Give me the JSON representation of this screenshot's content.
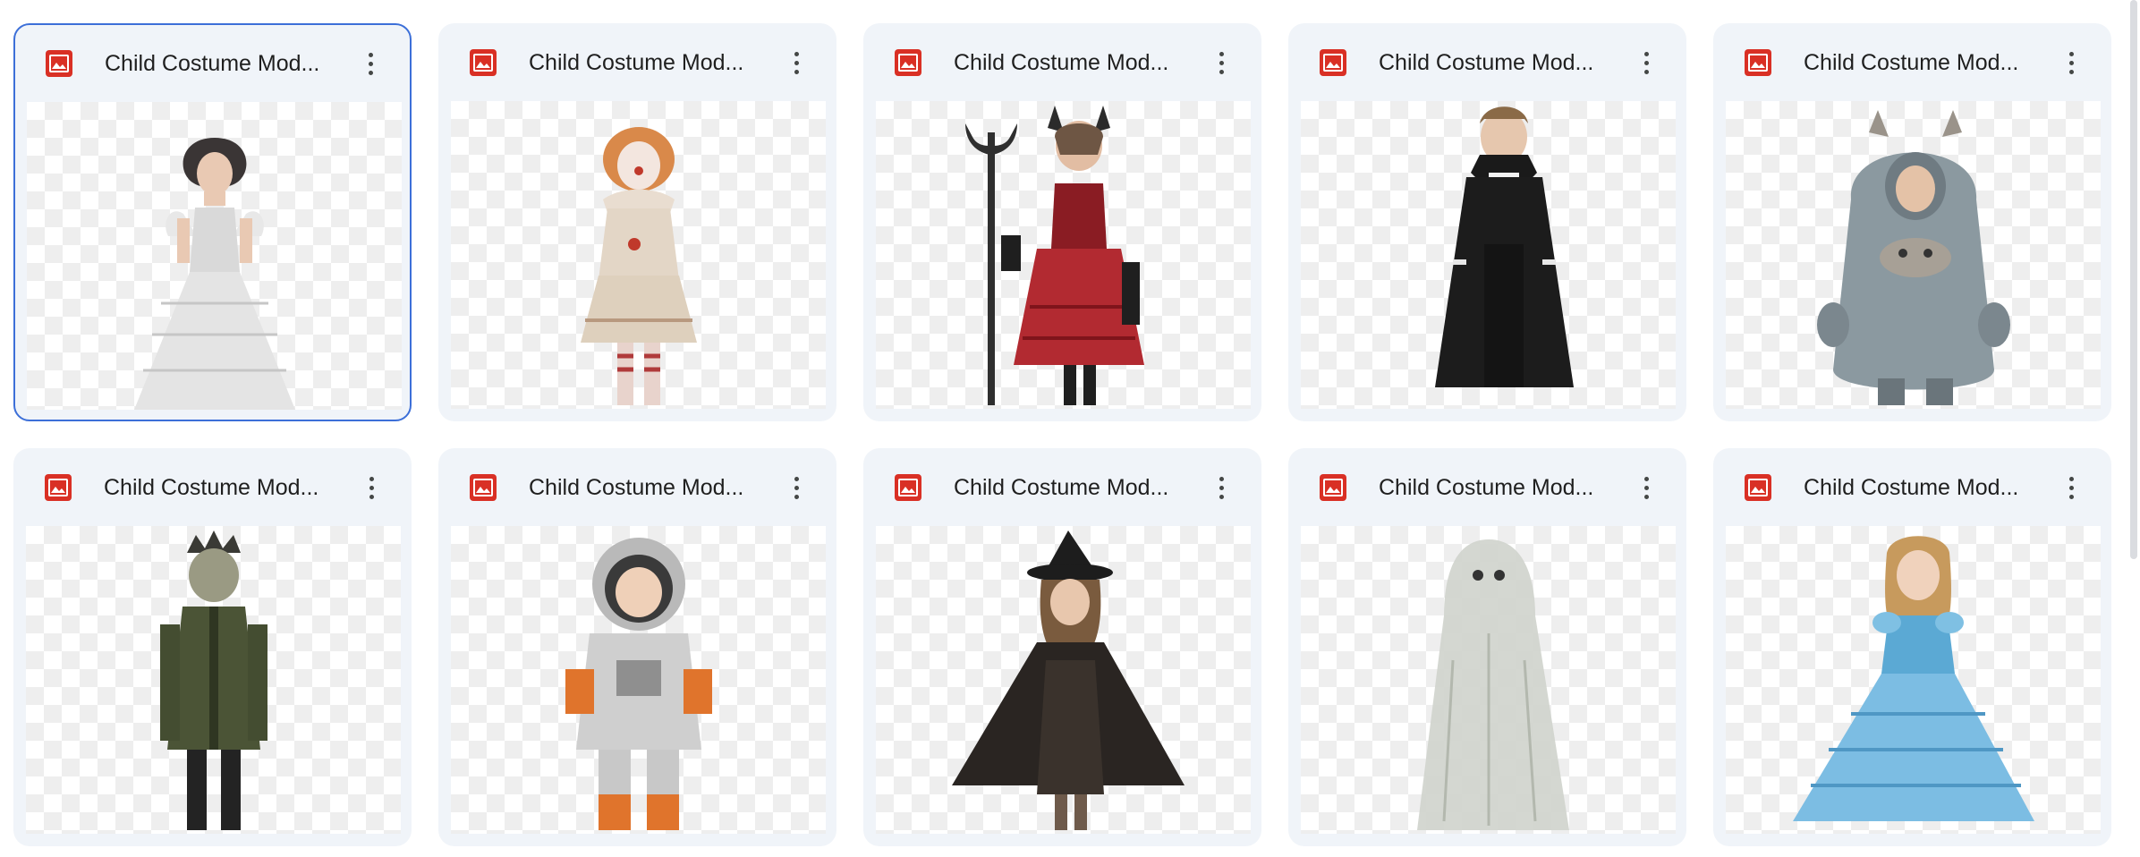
{
  "files": [
    {
      "title": "Child Costume Mod...",
      "file_type_icon": "image-file-icon",
      "subject": "bride",
      "selected": true
    },
    {
      "title": "Child Costume Mod...",
      "file_type_icon": "image-file-icon",
      "subject": "clown",
      "selected": false
    },
    {
      "title": "Child Costume Mod...",
      "file_type_icon": "image-file-icon",
      "subject": "devil",
      "selected": false
    },
    {
      "title": "Child Costume Mod...",
      "file_type_icon": "image-file-icon",
      "subject": "vampire",
      "selected": false
    },
    {
      "title": "Child Costume Mod...",
      "file_type_icon": "image-file-icon",
      "subject": "monster",
      "selected": false
    },
    {
      "title": "Child Costume Mod...",
      "file_type_icon": "image-file-icon",
      "subject": "zombie",
      "selected": false
    },
    {
      "title": "Child Costume Mod...",
      "file_type_icon": "image-file-icon",
      "subject": "astronaut",
      "selected": false
    },
    {
      "title": "Child Costume Mod...",
      "file_type_icon": "image-file-icon",
      "subject": "witch",
      "selected": false
    },
    {
      "title": "Child Costume Mod...",
      "file_type_icon": "image-file-icon",
      "subject": "ghost",
      "selected": false
    },
    {
      "title": "Child Costume Mod...",
      "file_type_icon": "image-file-icon",
      "subject": "princess",
      "selected": false
    }
  ],
  "colors": {
    "card_background": "#f0f4f9",
    "selected_border": "#3c6fd8",
    "image_icon": "#d93025",
    "title_text": "#1f1f1f"
  }
}
